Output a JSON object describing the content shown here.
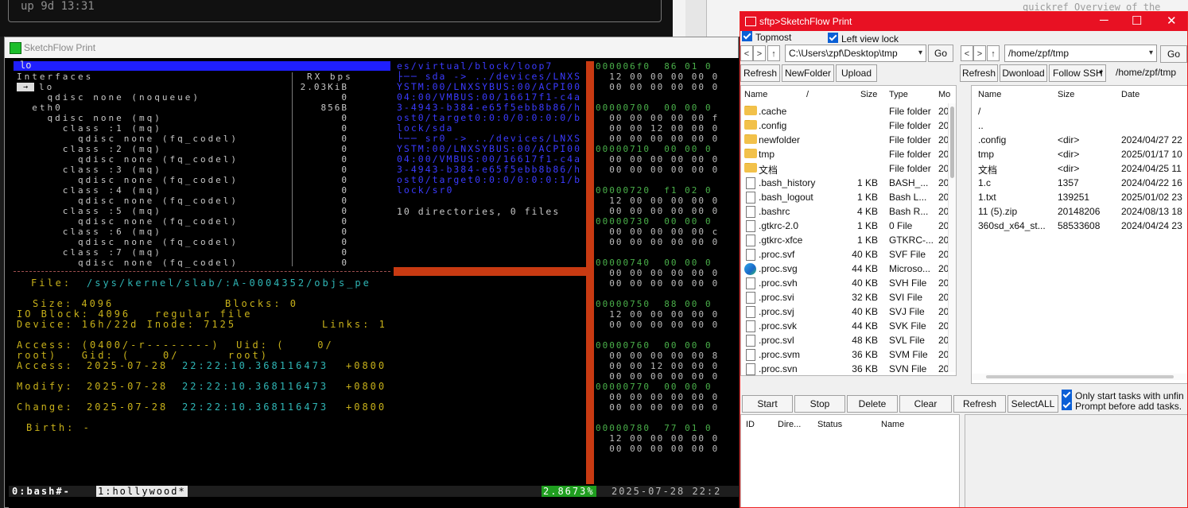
{
  "background": {
    "uptime_text": "up 9d 13:31",
    "quickref_text": "quickref       Overview of the"
  },
  "left_window": {
    "title": "SketchFlow Print",
    "pane_header": "lo",
    "interfaces_label": "Interfaces",
    "rx_label": "RX bps",
    "interfaces": [
      {
        "name": "lo",
        "value": "2.03KiB",
        "selected": true
      },
      {
        "name": "    qdisc none (noqueue)",
        "value": "0"
      },
      {
        "name": "  eth0",
        "value": "856B"
      },
      {
        "name": "    qdisc none (mq)",
        "value": "0"
      },
      {
        "name": "      class :1 (mq)",
        "value": "0"
      },
      {
        "name": "        qdisc none (fq_codel)",
        "value": "0"
      },
      {
        "name": "      class :2 (mq)",
        "value": "0"
      },
      {
        "name": "        qdisc none (fq_codel)",
        "value": "0"
      },
      {
        "name": "      class :3 (mq)",
        "value": "0"
      },
      {
        "name": "        qdisc none (fq_codel)",
        "value": "0"
      },
      {
        "name": "      class :4 (mq)",
        "value": "0"
      },
      {
        "name": "        qdisc none (fq_codel)",
        "value": "0"
      },
      {
        "name": "      class :5 (mq)",
        "value": "0"
      },
      {
        "name": "        qdisc none (fq_codel)",
        "value": "0"
      },
      {
        "name": "      class :6 (mq)",
        "value": "0"
      },
      {
        "name": "        qdisc none (fq_codel)",
        "value": "0"
      },
      {
        "name": "      class :7 (mq)",
        "value": "0"
      },
      {
        "name": "        qdisc none (fq_codel)",
        "value": "0"
      }
    ],
    "file_info": {
      "file_label": "File:",
      "file_path": "/sys/kernel/slab/:A-0004352/objs_pe",
      "size": "Size: 4096",
      "blocks": "Blocks: 0",
      "io_block": "IO Block: 4096   regular file",
      "device": "Device: 16h/22d Inode: 7125",
      "links": "Links: 1",
      "access_perm": "Access: (0400/-r--------)  Uid: (    0/",
      "root_gid": "root)   Gid: (    0/      root)",
      "access_label": "Access:",
      "access_date": "2025-07-28",
      "access_time": "22:22:10.368116473",
      "access_tz": "+0800",
      "modify_label": "Modify:",
      "modify_date": "2025-07-28",
      "modify_time": "22:22:10.368116473",
      "modify_tz": "+0800",
      "change_label": "Change:",
      "change_date": "2025-07-28",
      "change_time": "22:22:10.368116473",
      "change_tz": "+0800",
      "birth": "Birth: -"
    },
    "tree_lines": [
      "es/virtual/block/loop7",
      "├── sda -> ../devices/LNXSYSTM:00/LNXSYBUS:00/ACPI0004:00/VMBUS:00/16617f1-c4a3-4943-b384-e65f5ebb8b86/host0/target0:0:0/0:0:0:0/block/sda",
      "└── sr0 -> ../devices/LNXSYSTM:00/LNXSYBUS:00/ACPI0004:00/VMBUS:00/16617f1-c4a3-4943-b384-e65f5ebb8b86/host0/target0:0:0/0:0:0:1/block/sr0"
    ],
    "tree_summary": "10 directories, 0 files",
    "hex_lines": [
      "000006f0  86 01 0",
      "  12 00 00 00 00 0",
      "  00 00 00 00 00 0",
      "",
      "00000700  00 00 0",
      "  00 00 00 00 00 f",
      "  00 00 12 00 00 0",
      "  00 00 00 00 00 0",
      "00000710  00 00 0",
      "  00 00 00 00 00 0",
      "  00 00 00 00 00 0",
      "",
      "00000720  f1 02 0",
      "  12 00 00 00 00 0",
      "  00 00 00 00 00 0",
      "00000730  00 00 0",
      "  00 00 00 00 00 c",
      "  00 00 00 00 00 0",
      "",
      "00000740  00 00 0",
      "  00 00 00 00 00 0",
      "  00 00 00 00 00 0",
      "",
      "00000750  88 00 0",
      "  12 00 00 00 00 0",
      "  00 00 00 00 00 0",
      "",
      "00000760  00 00 0",
      "  00 00 00 00 00 8",
      "  00 00 12 00 00 0",
      "  00 00 00 00 00 0",
      "00000770  00 00 0",
      "  00 00 00 00 00 0",
      "  00 00 00 00 00 0",
      "",
      "00000780  77 01 0",
      "  12 00 00 00 00 0",
      "  00 00 00 00 00 0"
    ],
    "status": {
      "session": "0:bash#-",
      "window": "1:hollywood*",
      "percent": "2.8673%",
      "datetime": "2025-07-28 22:2"
    }
  },
  "right_window": {
    "title": "sftp>SketchFlow Print",
    "topmost_label": "Topmost",
    "left_view_lock_label": "Left view lock",
    "local_path": "C:\\Users\\zpf\\Desktop\\tmp",
    "remote_path": "/home/zpf/tmp",
    "go_label": "Go",
    "local_buttons": [
      "Refresh",
      "NewFolder",
      "Upload"
    ],
    "remote_buttons": [
      "Refresh",
      "Dwonload",
      "Follow SSH"
    ],
    "remote_path_label": "/home/zpf/tmp",
    "local_columns": [
      "Name",
      "/",
      "Size",
      "Type",
      "Mo"
    ],
    "local_files": [
      {
        "name": ".cache",
        "size": "",
        "type": "File folder",
        "mod": "20",
        "icon": "folder"
      },
      {
        "name": ".config",
        "size": "",
        "type": "File folder",
        "mod": "20",
        "icon": "folder"
      },
      {
        "name": "newfolder",
        "size": "",
        "type": "File folder",
        "mod": "20",
        "icon": "folder"
      },
      {
        "name": "tmp",
        "size": "",
        "type": "File folder",
        "mod": "20",
        "icon": "folder"
      },
      {
        "name": "文档",
        "size": "",
        "type": "File folder",
        "mod": "20",
        "icon": "folder"
      },
      {
        "name": ".bash_history",
        "size": "1 KB",
        "type": "BASH_...",
        "mod": "20",
        "icon": "file"
      },
      {
        "name": ".bash_logout",
        "size": "1 KB",
        "type": "Bash L...",
        "mod": "20",
        "icon": "file"
      },
      {
        "name": ".bashrc",
        "size": "4 KB",
        "type": "Bash R...",
        "mod": "20",
        "icon": "file"
      },
      {
        "name": ".gtkrc-2.0",
        "size": "1 KB",
        "type": "0 File",
        "mod": "20",
        "icon": "file"
      },
      {
        "name": ".gtkrc-xfce",
        "size": "1 KB",
        "type": "GTKRC-...",
        "mod": "20",
        "icon": "file"
      },
      {
        "name": ".proc.svf",
        "size": "40 KB",
        "type": "SVF File",
        "mod": "20",
        "icon": "file"
      },
      {
        "name": ".proc.svg",
        "size": "44 KB",
        "type": "Microso...",
        "mod": "20",
        "icon": "edge"
      },
      {
        "name": ".proc.svh",
        "size": "40 KB",
        "type": "SVH File",
        "mod": "20",
        "icon": "file"
      },
      {
        "name": ".proc.svi",
        "size": "32 KB",
        "type": "SVI File",
        "mod": "20",
        "icon": "file"
      },
      {
        "name": ".proc.svj",
        "size": "40 KB",
        "type": "SVJ File",
        "mod": "20",
        "icon": "file"
      },
      {
        "name": ".proc.svk",
        "size": "44 KB",
        "type": "SVK File",
        "mod": "20",
        "icon": "file"
      },
      {
        "name": ".proc.svl",
        "size": "48 KB",
        "type": "SVL File",
        "mod": "20",
        "icon": "file"
      },
      {
        "name": ".proc.svm",
        "size": "36 KB",
        "type": "SVM File",
        "mod": "20",
        "icon": "file"
      },
      {
        "name": ".proc.svn",
        "size": "36 KB",
        "type": "SVN File",
        "mod": "20",
        "icon": "file"
      }
    ],
    "remote_columns": [
      "Name",
      "Size",
      "Date"
    ],
    "remote_files": [
      {
        "name": "/",
        "size": "",
        "date": ""
      },
      {
        "name": "..",
        "size": "",
        "date": ""
      },
      {
        "name": ".config",
        "size": "<dir>",
        "date": "2024/04/27 22"
      },
      {
        "name": "tmp",
        "size": "<dir>",
        "date": "2025/01/17 10"
      },
      {
        "name": "文档",
        "size": "<dir>",
        "date": "2024/04/25 11"
      },
      {
        "name": "1.c",
        "size": "1357",
        "date": "2024/04/22 16"
      },
      {
        "name": "1.txt",
        "size": "139251",
        "date": "2025/01/02 23"
      },
      {
        "name": "11 (5).zip",
        "size": "20148206",
        "date": "2024/08/13 18"
      },
      {
        "name": "360sd_x64_st...",
        "size": "58533608",
        "date": "2024/04/24 23"
      }
    ],
    "task_buttons": [
      "Start",
      "Stop",
      "Delete",
      "Clear",
      "Refresh",
      "SelectALL"
    ],
    "only_start_label": "Only start tasks with unfin",
    "prompt_label": "Prompt before add tasks.",
    "task_columns": [
      "ID",
      "Dire...",
      "Status",
      "Name"
    ]
  }
}
